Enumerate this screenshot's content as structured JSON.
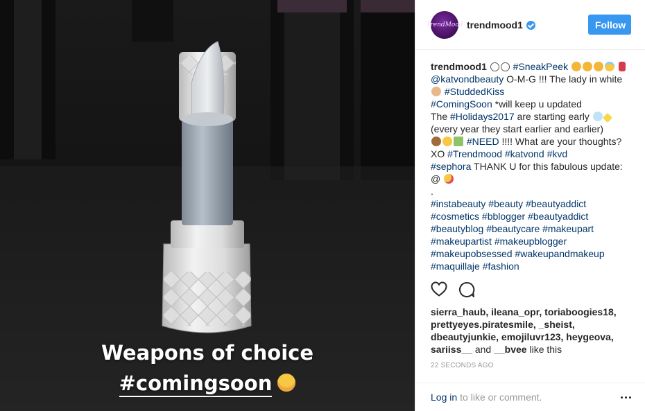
{
  "post": {
    "overlay_line1": "Weapons of choice",
    "overlay_hashtag": "#comingsoon"
  },
  "header": {
    "avatar_text": "TrendMood",
    "username": "trendmood1",
    "follow_label": "Follow"
  },
  "caption": {
    "username": "trendmood1",
    "t_sneakpeek": "#SneakPeek",
    "t_katvond_handle": "@katvondbeauty",
    "s_omg": " O-M-G !!! The lady in white ",
    "t_studdedkiss": "#StuddedKiss",
    "t_comingsoon": "#ComingSoon",
    "s_updated": " *will keep u updated",
    "s_the": "The ",
    "t_holidays": "#Holidays2017",
    "s_early": " are starting early ",
    "s_every": "(every year they start earlier and earlier)",
    "t_need": "#NEED",
    "s_what": " !!!! What are your thoughts? XO ",
    "t_trendmood": "#Trendmood",
    "t_katvond": "#katvond",
    "t_kvd": "#kvd",
    "t_sephora": "#sephora",
    "s_thank": " THANK U for this fabulous update: @ ",
    "s_dot": ".",
    "tags_block": [
      "#instabeauty",
      "#beauty",
      "#beautyaddict",
      "#cosmetics",
      "#bblogger",
      "#beautyaddict",
      "#beautyblog",
      "#beautycare",
      "#makeupart",
      "#makeupartist",
      "#makeupblogger",
      "#makeupobsessed",
      "#wakeupandmakeup",
      "#maquillaje",
      "#fashion"
    ]
  },
  "likes": {
    "users": "sierra_haub, ileana_opr, toriaboogies18, prettyeyes.piratesmile, _sheist, dbeautyjunkie, emojiluvr123, heygeova, sariiss__",
    "and": " and ",
    "last_user": "__bvee",
    "suffix": " like this"
  },
  "time_ago": "22 SECONDS AGO",
  "footer": {
    "login_label": "Log in",
    "rest_text": "to like or comment."
  },
  "icons": [
    "heart-icon",
    "comment-icon",
    "verified-badge-icon",
    "more-options-icon"
  ],
  "colors": {
    "accent": "#3897f0",
    "link": "#003569",
    "muted": "#999999"
  }
}
